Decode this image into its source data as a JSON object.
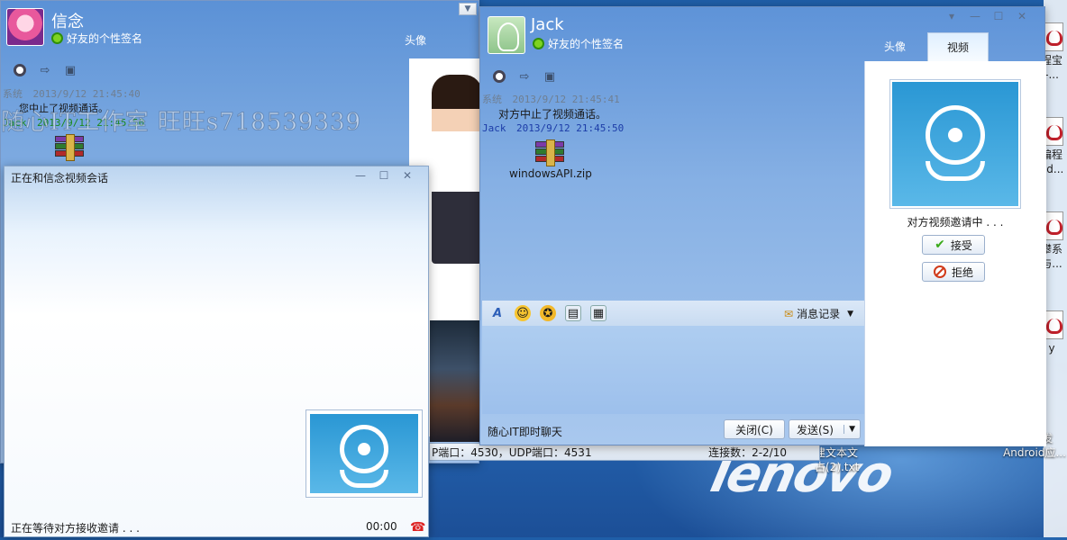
{
  "desktop": {
    "brand": "lenovo",
    "icons": [
      {
        "label": "程宝\n-..."
      },
      {
        "label": "编程\npd..."
      },
      {
        "label": "攀系\n与..."
      },
      {
        "label": "y"
      },
      {
        "label": "c#开发\nAndroid应..."
      }
    ],
    "partial_file": "建文本文\n占(2).txt"
  },
  "left_window": {
    "nickname": "信念",
    "signature": "好友的个性签名",
    "tab_avatar": "头像",
    "messages": [
      {
        "sender": "系统",
        "time": "2013/9/12 21:45:40",
        "text": "您中止了视频通话。"
      },
      {
        "sender": "Jack",
        "time": "2013/9/12 21:45:50",
        "file": "windowsAPI.zip"
      }
    ],
    "watermark": "随心IT工作室 旺旺s718539339",
    "status_bar": {
      "ports": "P端口：4530，UDP端口：4531",
      "connections": "连接数：2-2/10"
    }
  },
  "video_window": {
    "title": "正在和信念视频会话",
    "status": "正在等待对方接收邀请 . . .",
    "timer": "00:00"
  },
  "jack_window": {
    "nickname": "Jack",
    "signature": "好友的个性签名",
    "tabs": [
      "头像",
      "视频"
    ],
    "messages": [
      {
        "sender": "系统",
        "time": "2013/9/12 21:45:41",
        "text": "对方中止了视频通话。"
      },
      {
        "sender": "Jack",
        "time": "2013/9/12 21:45:50",
        "file": "windowsAPI.zip"
      }
    ],
    "history_label": "消息记录",
    "footer": "随心IT即时聊天",
    "close_label": "关闭(C)",
    "send_label": "发送(S)",
    "invite_text": "对方视频邀请中 . . .",
    "accept_label": "接受",
    "reject_label": "拒绝"
  }
}
